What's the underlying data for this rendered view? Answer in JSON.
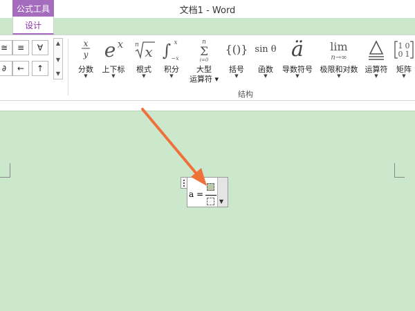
{
  "titlebar": {
    "document_title": "文档1 - Word",
    "context_tab_group": "公式工具",
    "active_tab": "设计"
  },
  "ribbon": {
    "symbol_buttons": [
      {
        "label": "≅"
      },
      {
        "label": "≡"
      },
      {
        "label": "∀"
      },
      {
        "label": "∂"
      },
      {
        "label": "←"
      },
      {
        "label": "↑"
      }
    ],
    "scroll": {
      "up": "▲",
      "down": "▼",
      "more": "▼"
    },
    "structure_tools": [
      {
        "icon_text": "x/y",
        "label": "分数",
        "label2": ""
      },
      {
        "icon_text": "eˣ",
        "label": "上下标",
        "label2": ""
      },
      {
        "icon_text": "ⁿ√x",
        "label": "根式",
        "label2": ""
      },
      {
        "icon_text": "∫",
        "label": "积分",
        "label2": ""
      },
      {
        "icon_text": "Σ",
        "label": "大型",
        "label2": "运算符"
      },
      {
        "icon_text": "{()}",
        "label": "括号",
        "label2": ""
      },
      {
        "icon_text": "sin θ",
        "label": "函数",
        "label2": ""
      },
      {
        "icon_text": "ä",
        "label": "导数符号",
        "label2": ""
      },
      {
        "icon_text": "lim",
        "label": "极限和对数",
        "label2": ""
      },
      {
        "icon_text": "Δ",
        "label": "运算符",
        "label2": ""
      },
      {
        "icon_text": "[10 01]",
        "label": "矩阵",
        "label2": ""
      }
    ],
    "group_label": "结构"
  },
  "document": {
    "equation_prefix": "a ="
  },
  "colors": {
    "context_tab": "#a56bbd",
    "canvas_bg": "#cce8cc",
    "arrow": "#f0703a"
  }
}
